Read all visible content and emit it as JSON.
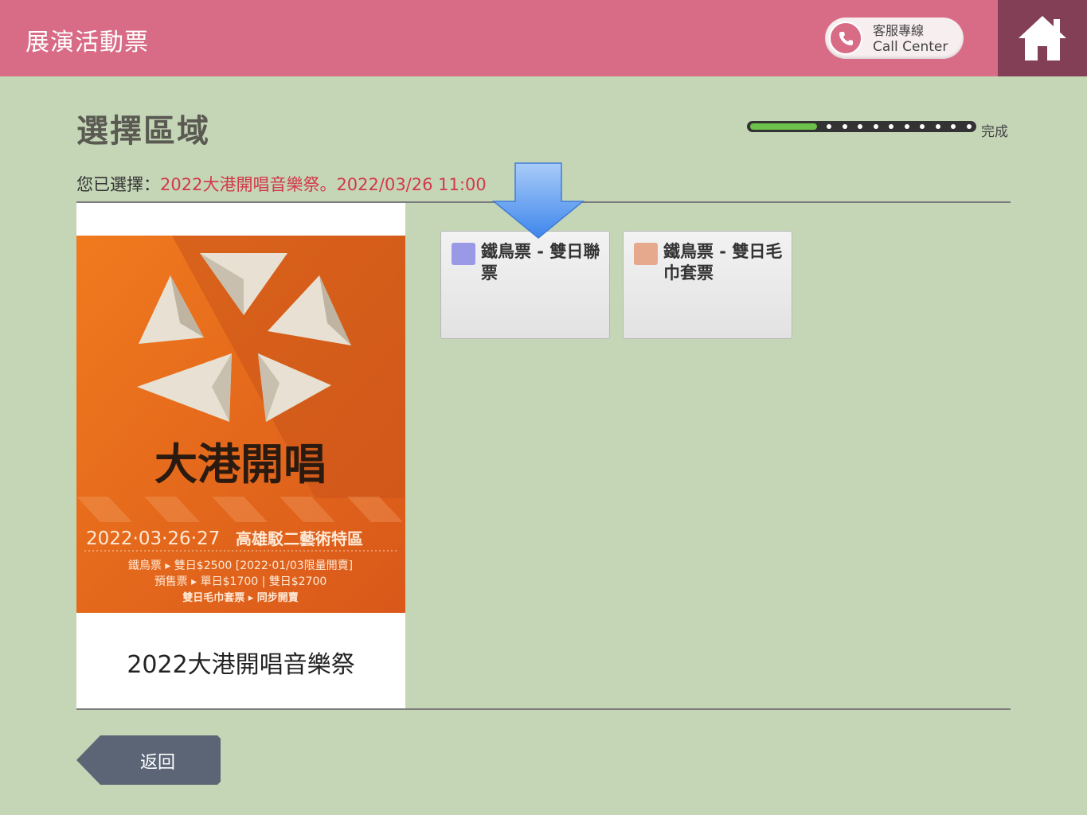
{
  "header": {
    "title": "展演活動票",
    "call_center": {
      "label_zh": "客服專線",
      "label_en": "Call Center"
    },
    "home_icon": "home-icon",
    "phone_icon": "phone-icon"
  },
  "page": {
    "title": "選擇區域",
    "progress": {
      "label": "完成",
      "fraction": 0.3,
      "total_steps": 10
    }
  },
  "selection": {
    "prefix": "您已選擇：",
    "value": "2022大港開唱音樂祭。2022/03/26 11:00"
  },
  "event": {
    "name": "2022大港開唱音樂祭",
    "poster": {
      "title": "大港開唱",
      "date_line": "2022·03·26‧27",
      "venue": "高雄駁二藝術特區",
      "line1": "鐵鳥票 ▸ 雙日$2500 [2022·01/03限量開賣]",
      "line2": "預售票 ▸ 單日$1700 | 雙日$2700",
      "line3": "雙日毛巾套票 ▸ 同步開賣"
    }
  },
  "tickets": [
    {
      "name": "鐵鳥票 - 雙日聯票",
      "color": "#9999e6"
    },
    {
      "name": "鐵鳥票 - 雙日毛巾套票",
      "color": "#e6a98e"
    }
  ],
  "colors": {
    "header": "#d86c86",
    "home": "#823f55",
    "background": "#c5d6b7",
    "selected_text": "#d2394a",
    "progress_fill": "#6cc24a",
    "back_button": "#5b6576",
    "arrow": "#5b9bf0"
  },
  "back_button": {
    "label": "返回"
  }
}
